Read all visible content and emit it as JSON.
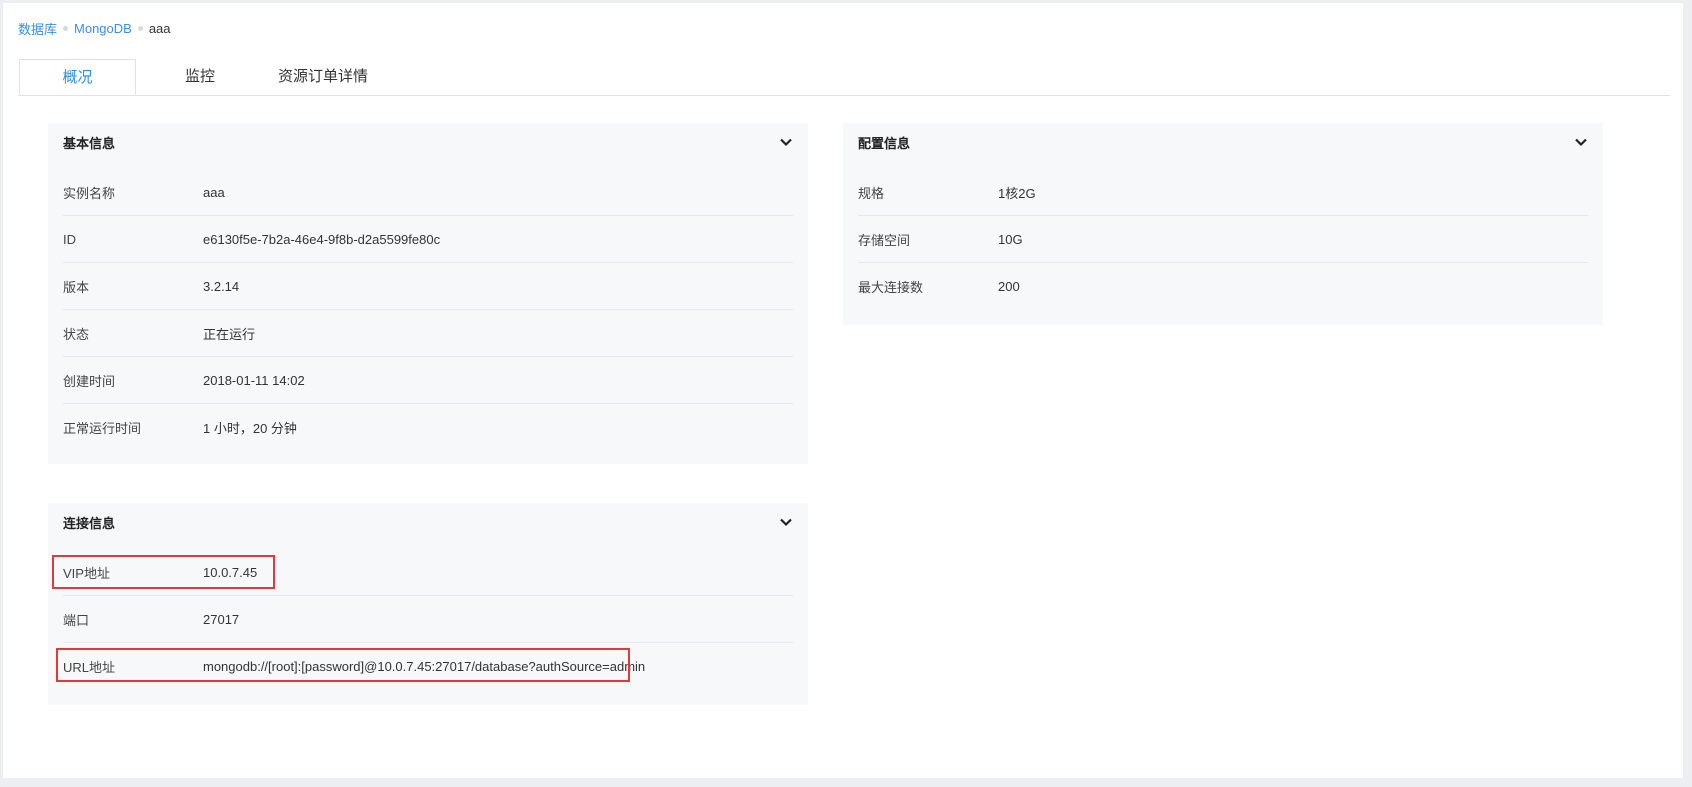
{
  "breadcrumb": [
    "数据库",
    "MongoDB",
    "aaa"
  ],
  "tabs": [
    "概况",
    "监控",
    "资源订单详情"
  ],
  "basic_info": {
    "title": "基本信息",
    "rows": [
      {
        "k": "实例名称",
        "v": "aaa"
      },
      {
        "k": "ID",
        "v": "e6130f5e-7b2a-46e4-9f8b-d2a5599fe80c"
      },
      {
        "k": "版本",
        "v": "3.2.14"
      },
      {
        "k": "状态",
        "v": "正在运行"
      },
      {
        "k": "创建时间",
        "v": "2018-01-11 14:02"
      },
      {
        "k": "正常运行时间",
        "v": "1 小时，20 分钟"
      }
    ]
  },
  "config_info": {
    "title": "配置信息",
    "rows": [
      {
        "k": "规格",
        "v": "1核2G"
      },
      {
        "k": "存储空间",
        "v": "10G"
      },
      {
        "k": "最大连接数",
        "v": "200"
      }
    ]
  },
  "conn_info": {
    "title": "连接信息",
    "rows": [
      {
        "k": "VIP地址",
        "v": "10.0.7.45"
      },
      {
        "k": "端口",
        "v": "27017"
      },
      {
        "k": "URL地址",
        "v": "mongodb://[root]:[password]@10.0.7.45:27017/database?authSource=admin"
      }
    ]
  },
  "icons": {
    "collapse": "chevron-down-icon"
  },
  "colors": {
    "accent": "#2d8cf0",
    "highlight": "#e03a3a",
    "card_bg": "#f7f8fa"
  }
}
